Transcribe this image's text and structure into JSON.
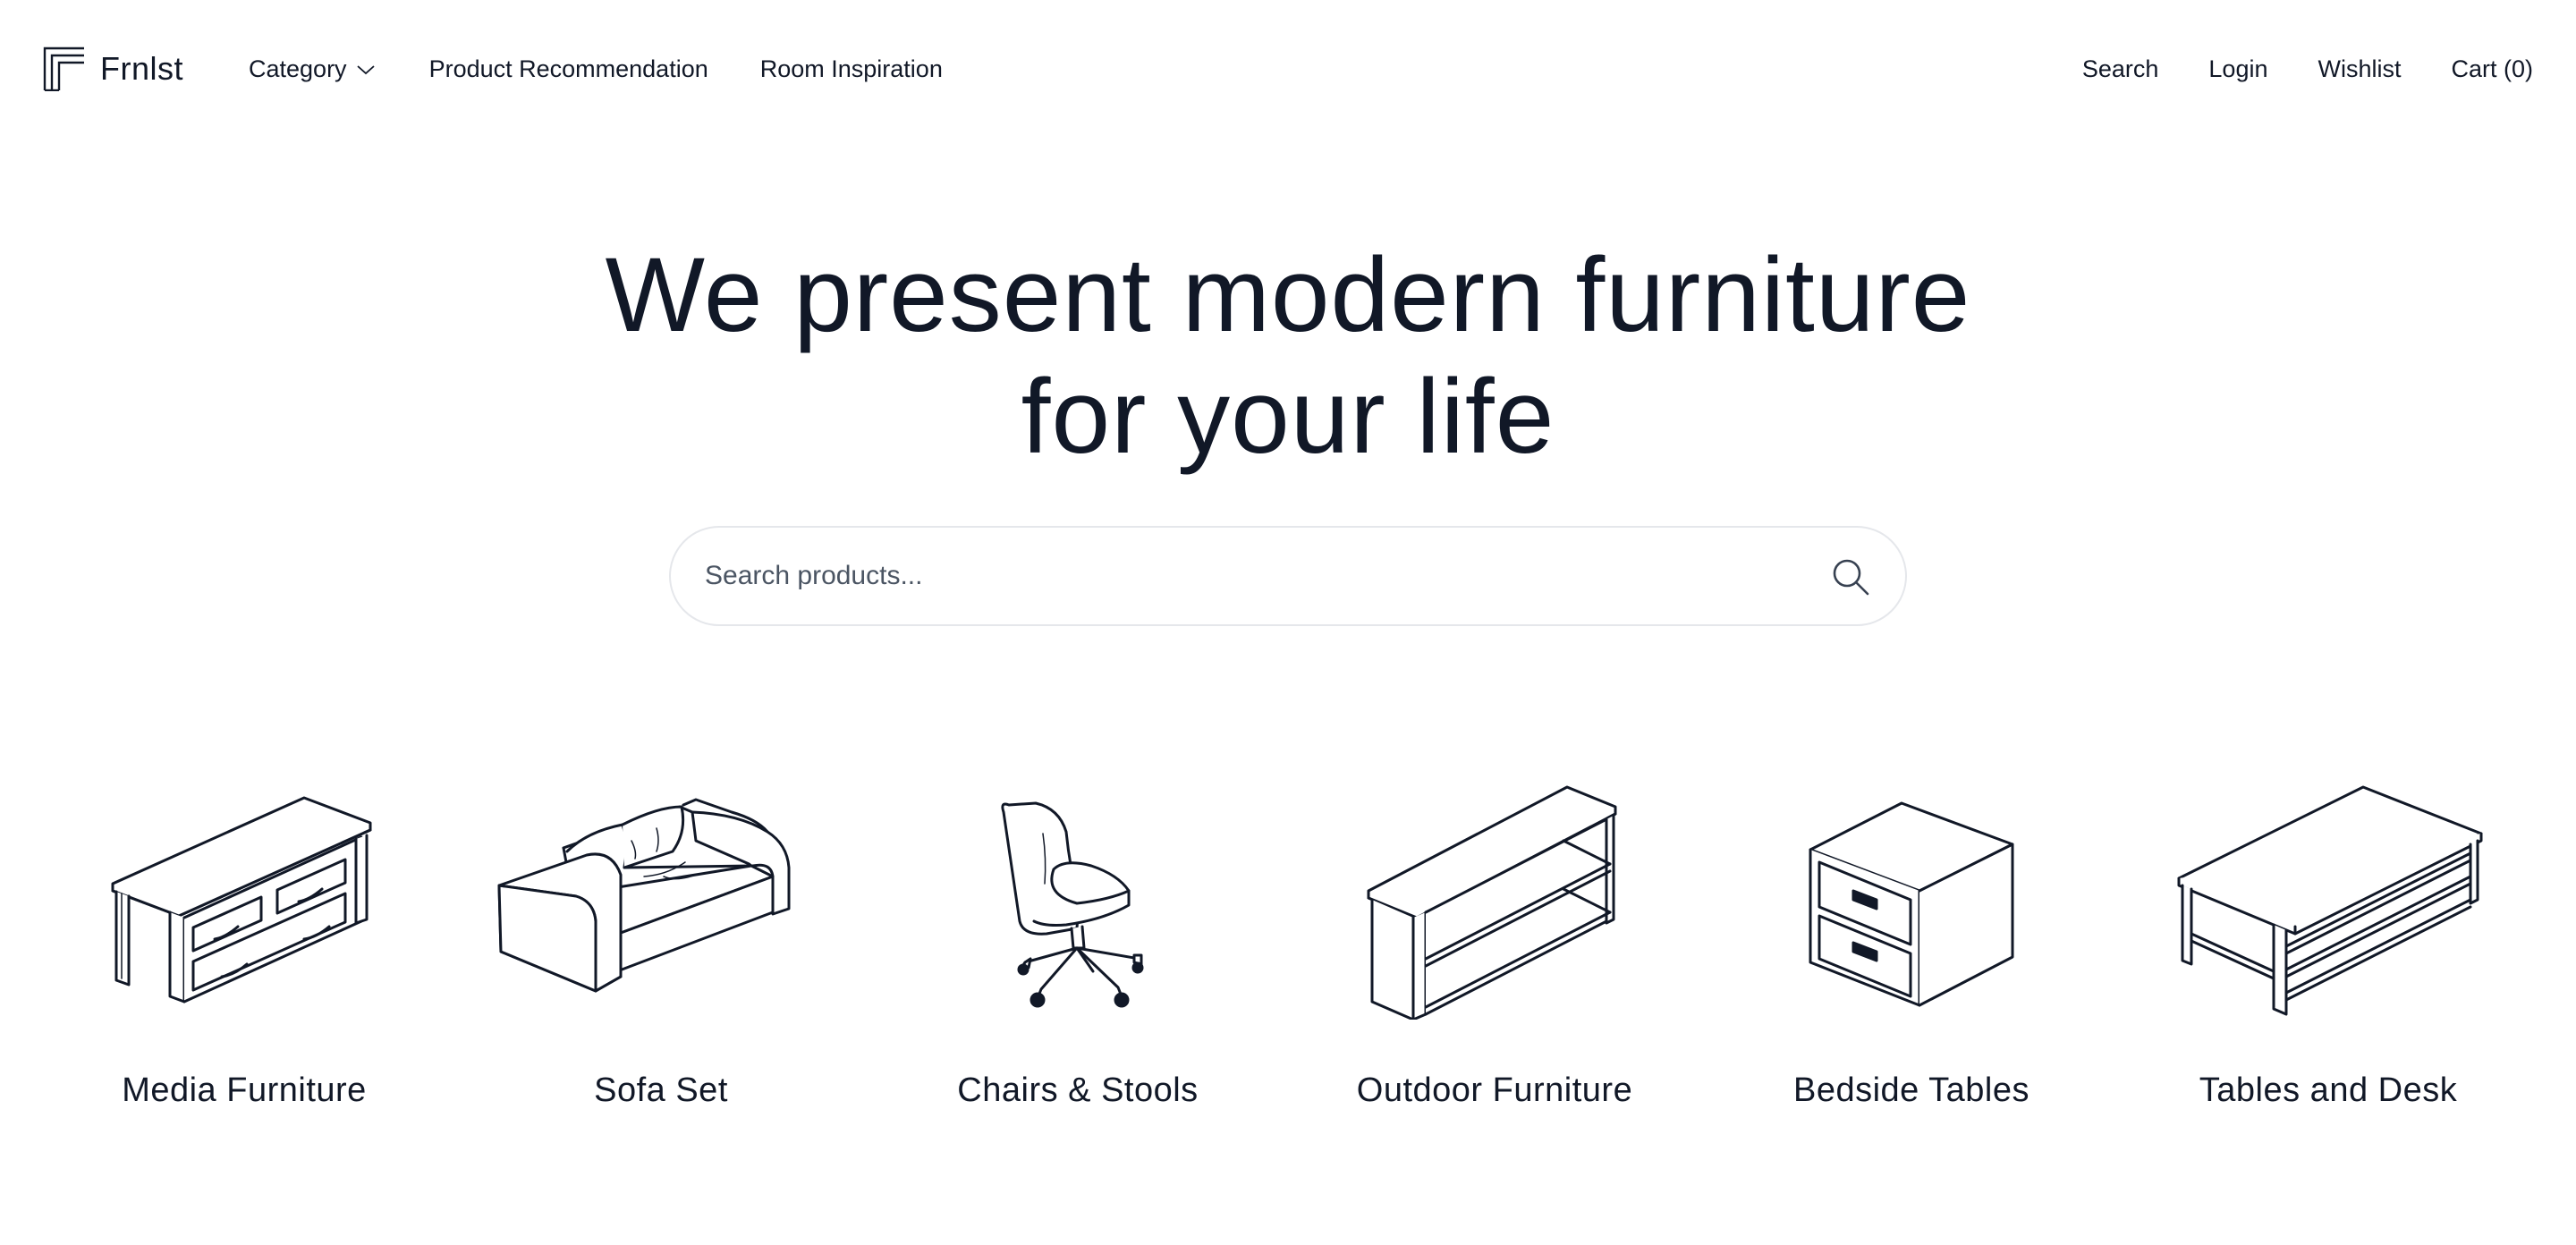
{
  "brand": {
    "name": "Frnlst",
    "logo_icon": "frnlst-logo-icon"
  },
  "nav": {
    "left": [
      {
        "label": "Category",
        "icon": "chevron-down-icon"
      },
      {
        "label": "Product Recommendation"
      },
      {
        "label": "Room Inspiration"
      }
    ],
    "right": [
      {
        "label": "Search"
      },
      {
        "label": "Login"
      },
      {
        "label": "Wishlist"
      },
      {
        "label": "Cart (0)"
      }
    ]
  },
  "hero": {
    "title_line1": "We present modern furniture",
    "title_line2": "for your life"
  },
  "search": {
    "placeholder": "Search products...",
    "value": "",
    "icon": "search-icon"
  },
  "categories": [
    {
      "label": "Media Furniture",
      "icon": "media-furniture-icon"
    },
    {
      "label": "Sofa Set",
      "icon": "sofa-icon"
    },
    {
      "label": "Chairs & Stools",
      "icon": "office-chair-icon"
    },
    {
      "label": "Outdoor Furniture",
      "icon": "open-shelf-icon"
    },
    {
      "label": "Bedside Tables",
      "icon": "nightstand-icon"
    },
    {
      "label": "Tables and Desk",
      "icon": "table-icon"
    }
  ],
  "colors": {
    "text": "#111827",
    "border": "#e5e7eb",
    "placeholder": "#4b5563",
    "background": "#ffffff"
  }
}
